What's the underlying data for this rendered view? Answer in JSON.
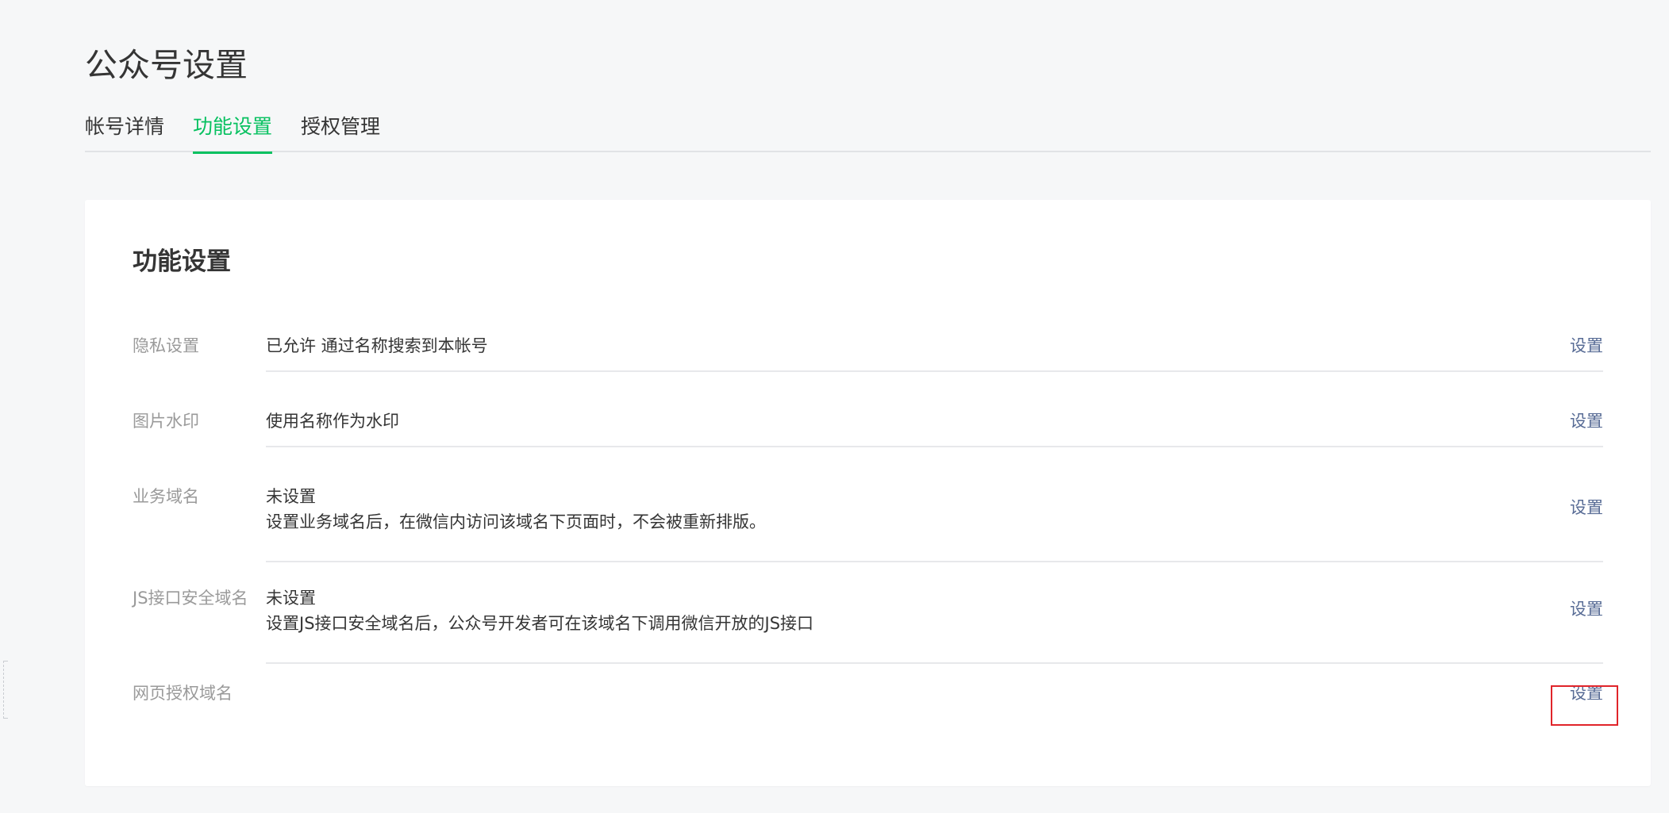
{
  "page": {
    "title": "公众号设置"
  },
  "tabs": [
    {
      "label": "帐号详情",
      "active": false
    },
    {
      "label": "功能设置",
      "active": true
    },
    {
      "label": "授权管理",
      "active": false
    }
  ],
  "card": {
    "title": "功能设置",
    "rows": [
      {
        "label": "隐私设置",
        "value": "已允许 通过名称搜索到本帐号",
        "desc": "",
        "action": "设置"
      },
      {
        "label": "图片水印",
        "value": "使用名称作为水印",
        "desc": "",
        "action": "设置"
      },
      {
        "label": "业务域名",
        "value": "未设置",
        "desc": "设置业务域名后，在微信内访问该域名下页面时，不会被重新排版。",
        "action": "设置"
      },
      {
        "label": "JS接口安全域名",
        "value": "未设置",
        "desc": "设置JS接口安全域名后，公众号开发者可在该域名下调用微信开放的JS接口",
        "action": "设置"
      },
      {
        "label": "网页授权域名",
        "value": "",
        "desc": "",
        "action": "设置"
      }
    ]
  },
  "colors": {
    "accent": "#07c160",
    "link": "#576b95",
    "highlight": "#e0242a"
  }
}
